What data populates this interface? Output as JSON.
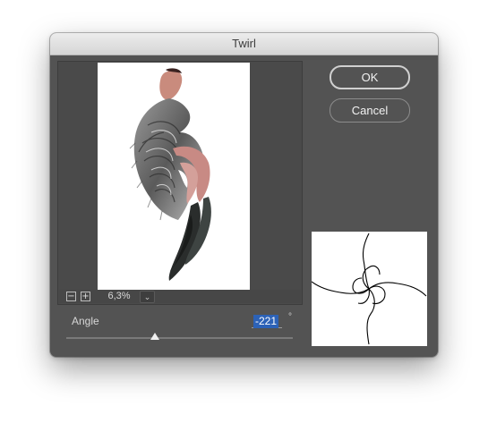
{
  "window": {
    "title": "Twirl"
  },
  "buttons": {
    "ok": "OK",
    "cancel": "Cancel"
  },
  "zoom": {
    "value": "6,3%",
    "minus_icon": "minus-icon",
    "plus_icon": "plus-icon",
    "dropdown_icon": "chevron-down-icon"
  },
  "angle": {
    "label": "Angle",
    "value": "-221",
    "unit": "°",
    "min": -999,
    "max": 999,
    "slider_fraction": 0.39
  },
  "colors": {
    "dialog_bg": "#535353",
    "selection": "#2c62b7",
    "preview_bg": "#ffffff"
  }
}
